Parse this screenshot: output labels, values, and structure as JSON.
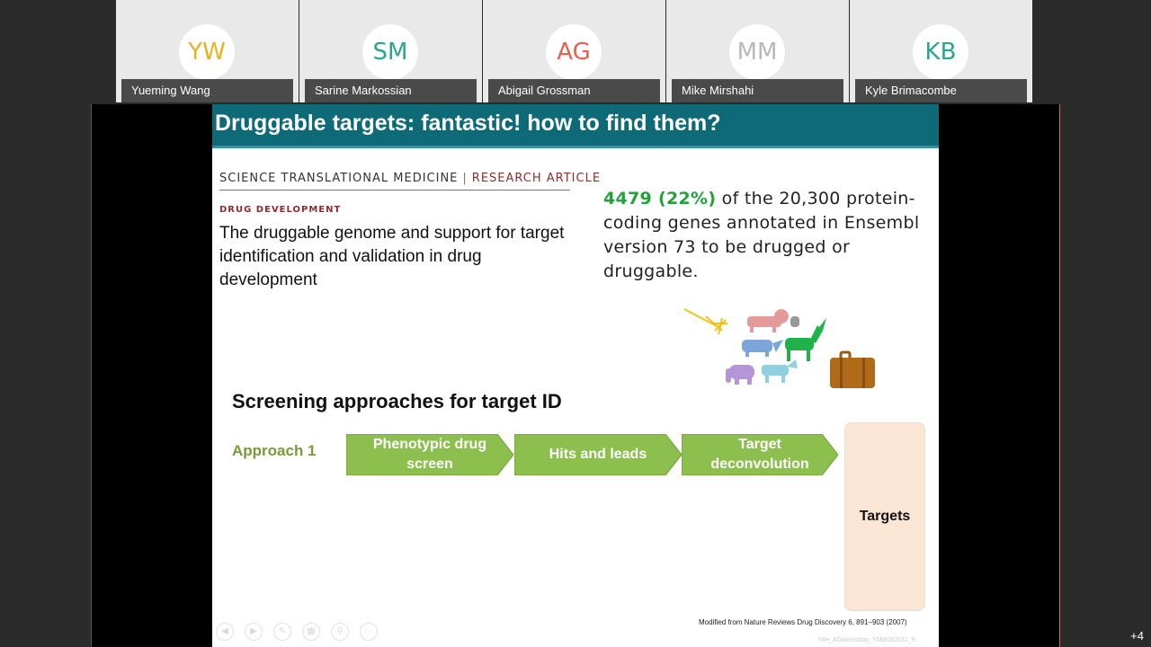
{
  "participants": [
    {
      "initials": "YW",
      "name": "Yueming Wang",
      "color": "#e6b21e"
    },
    {
      "initials": "SM",
      "name": "Sarine Markossian",
      "color": "#2aa58e"
    },
    {
      "initials": "AG",
      "name": "Abigail Grossman",
      "color": "#e2624f"
    },
    {
      "initials": "MM",
      "name": "Mike Mirshahi",
      "color": "#b8b8b8"
    },
    {
      "initials": "KB",
      "name": "Kyle Brimacombe",
      "color": "#2aa58e"
    }
  ],
  "slide": {
    "title": "Druggable targets: fantastic! how to find them?",
    "journal": "SCIENCE TRANSLATIONAL MEDICINE",
    "article_type": "RESEARCH ARTICLE",
    "section": "DRUG DEVELOPMENT",
    "article_title": "The druggable genome and support for target identification and validation in drug development",
    "stat_highlight": "4479 (22%)",
    "stat_text": " of the 20,300 protein-coding genes annotated in Ensembl version 73 to be drugged or druggable.",
    "screening_heading": "Screening approaches for target ID",
    "approach_label": "Approach 1",
    "steps": [
      "Phenotypic drug screen",
      "Hits and leads",
      "Target deconvolution"
    ],
    "targets_label": "Targets",
    "footnote": "Modified from Nature Reviews Drug Discovery  6, 891–903 (2007)",
    "watermark": "NIH_AGworkshop_YMW202011_9",
    "colors": {
      "title_bar": "#0f6a78",
      "chevron": "#8cbf4e",
      "highlight": "#1fa33a",
      "targets_box": "#fbe5d4"
    }
  },
  "overflow_count": "+4",
  "icons": [
    "unicorn-illustration-icon",
    "briefcase-icon",
    "prev-slide-icon",
    "next-slide-icon",
    "pen-icon",
    "slides-icon",
    "zoom-icon",
    "more-icon"
  ]
}
